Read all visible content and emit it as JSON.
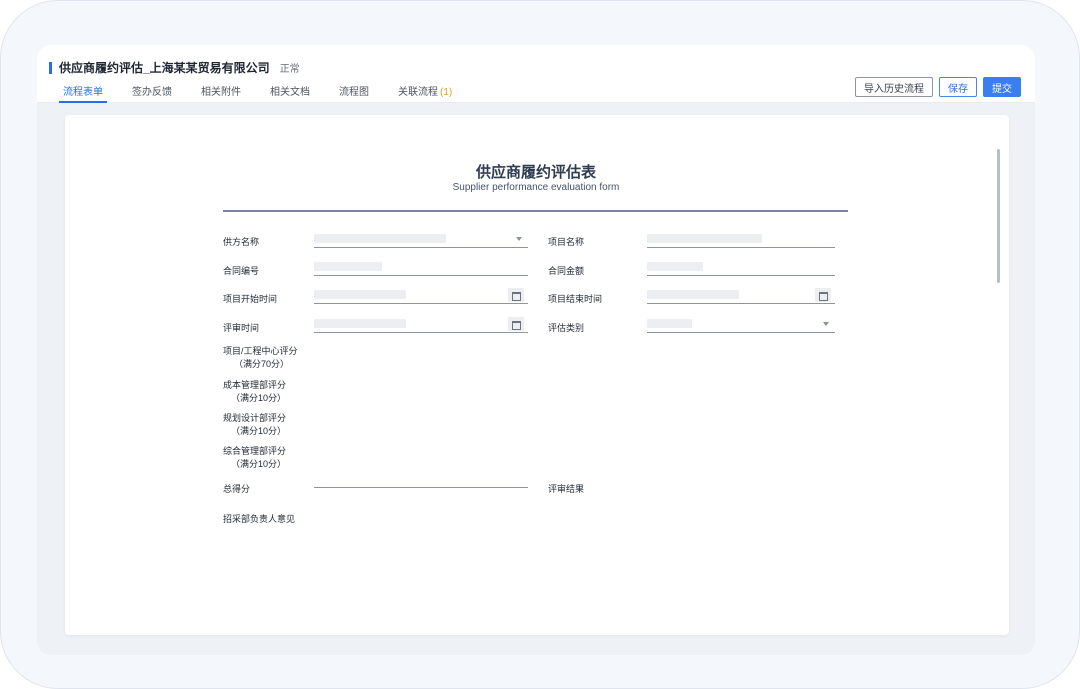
{
  "header": {
    "title": "供应商履约评估_上海某某贸易有限公司",
    "status": "正常",
    "tabs": [
      {
        "label": "流程表单",
        "active": true
      },
      {
        "label": "签办反馈"
      },
      {
        "label": "相关附件"
      },
      {
        "label": "相关文档"
      },
      {
        "label": "流程图"
      },
      {
        "label": "关联流程",
        "count": "(1)"
      }
    ],
    "buttons": {
      "import_history": "导入历史流程",
      "save": "保存",
      "submit": "提交"
    }
  },
  "form": {
    "title": "供应商履约评估表",
    "subtitle": "Supplier performance evaluation form",
    "fields": {
      "supplier_name": "供方名称",
      "project_name": "项目名称",
      "contract_no": "合同编号",
      "contract_amount": "合同金额",
      "project_start": "项目开始时间",
      "project_end": "项目结束时间",
      "review_time": "评审时间",
      "eval_category": "评估类别",
      "project_center_score": "项目/工程中心评分",
      "project_center_score_sub": "（满分70分）",
      "cost_dept_score": "成本管理部评分",
      "cost_dept_score_sub": "（满分10分）",
      "design_dept_score": "规划设计部评分",
      "design_dept_score_sub": "（满分10分）",
      "admin_dept_score": "综合管理部评分",
      "admin_dept_score_sub": "（满分10分）",
      "total_score": "总得分",
      "review_result": "评审结果",
      "procurement_opinion": "招采部负责人意见"
    }
  },
  "colors": {
    "accent": "#2b6de5",
    "primary_button": "#3b7ef0",
    "tab_count": "#e0a31e",
    "rule": "#7582a0"
  }
}
